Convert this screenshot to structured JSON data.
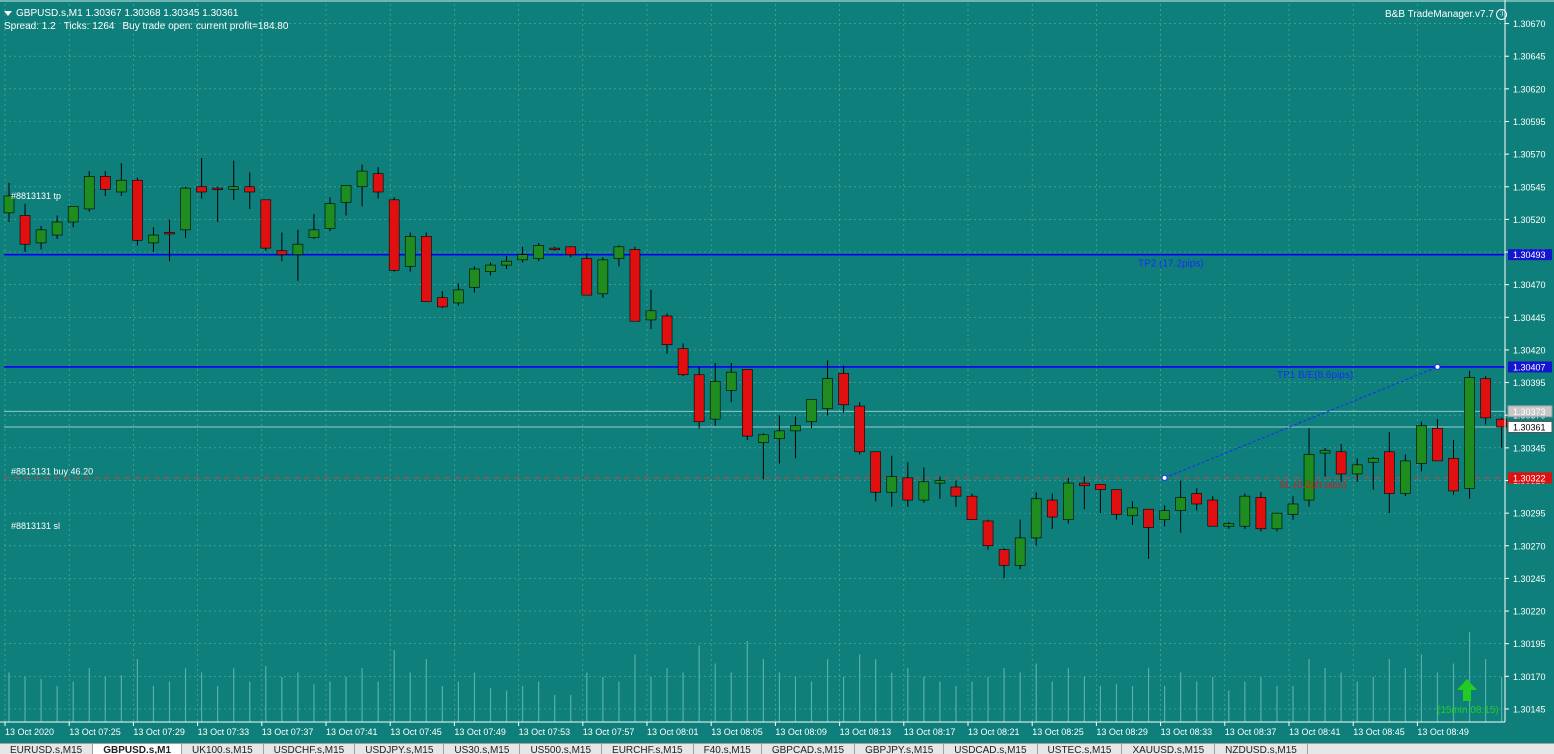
{
  "header": {
    "symbol_line": "GBPUSD.s,M1  1.30367 1.30368 1.30345 1.30361",
    "spread": "Spread: 1.2",
    "ticks": "Ticks: 1264",
    "trade_status": "Buy trade open: current profit=184.80"
  },
  "trade_manager_label": "B&B TradeManager.v7.7",
  "colors": {
    "background": "#0e7f7a",
    "grid": "#7fc3c0",
    "bull_candle": "#1e8c1e",
    "bear_candle": "#e01010",
    "candle_outline": "#000000",
    "tp_line": "#0000ff",
    "entry_line": "#d04040",
    "volume": "#56b0aa",
    "axis_text": "#ffffff",
    "price_box_blue": "#1515d0",
    "price_box_red": "#e01010",
    "arrow": "#22cc22"
  },
  "chart_data": {
    "type": "candlestick",
    "symbol": "GBPUSD.s",
    "timeframe": "M1",
    "ylim": [
      1.30135,
      1.30685
    ],
    "y_ticks": [
      "1.30670",
      "1.30645",
      "1.30620",
      "1.30595",
      "1.30570",
      "1.30545",
      "1.30520",
      "1.30495",
      "1.30470",
      "1.30445",
      "1.30420",
      "1.30395",
      "1.30370",
      "1.30345",
      "1.30320",
      "1.30295",
      "1.30270",
      "1.30245",
      "1.30220",
      "1.30195",
      "1.30170",
      "1.30145"
    ],
    "x_ticks": [
      "13 Oct 2020",
      "13 Oct 07:25",
      "13 Oct 07:29",
      "13 Oct 07:33",
      "13 Oct 07:37",
      "13 Oct 07:41",
      "13 Oct 07:45",
      "13 Oct 07:49",
      "13 Oct 07:53",
      "13 Oct 07:57",
      "13 Oct 08:01",
      "13 Oct 08:05",
      "13 Oct 08:09",
      "13 Oct 08:13",
      "13 Oct 08:17",
      "13 Oct 08:21",
      "13 Oct 08:25",
      "13 Oct 08:29",
      "13 Oct 08:33",
      "13 Oct 08:37",
      "13 Oct 08:41",
      "13 Oct 08:45",
      "13 Oct 08:49"
    ],
    "candles": [
      {
        "o": 1.30525,
        "h": 1.30548,
        "l": 1.30518,
        "c": 1.30538
      },
      {
        "o": 1.30523,
        "h": 1.30532,
        "l": 1.30495,
        "c": 1.30501
      },
      {
        "o": 1.30502,
        "h": 1.30515,
        "l": 1.30497,
        "c": 1.30512
      },
      {
        "o": 1.30508,
        "h": 1.30523,
        "l": 1.30505,
        "c": 1.30518
      },
      {
        "o": 1.30518,
        "h": 1.3053,
        "l": 1.30514,
        "c": 1.3053
      },
      {
        "o": 1.30528,
        "h": 1.30557,
        "l": 1.30526,
        "c": 1.30553
      },
      {
        "o": 1.30553,
        "h": 1.30557,
        "l": 1.30538,
        "c": 1.30543
      },
      {
        "o": 1.30541,
        "h": 1.30563,
        "l": 1.30538,
        "c": 1.3055
      },
      {
        "o": 1.3055,
        "h": 1.30552,
        "l": 1.305,
        "c": 1.30504
      },
      {
        "o": 1.30502,
        "h": 1.30514,
        "l": 1.30495,
        "c": 1.30508
      },
      {
        "o": 1.3051,
        "h": 1.3052,
        "l": 1.30488,
        "c": 1.30509
      },
      {
        "o": 1.30512,
        "h": 1.30545,
        "l": 1.30506,
        "c": 1.30544
      },
      {
        "o": 1.30545,
        "h": 1.30567,
        "l": 1.30536,
        "c": 1.30541
      },
      {
        "o": 1.30544,
        "h": 1.30545,
        "l": 1.30518,
        "c": 1.30543
      },
      {
        "o": 1.30543,
        "h": 1.30565,
        "l": 1.30535,
        "c": 1.30545
      },
      {
        "o": 1.30545,
        "h": 1.30556,
        "l": 1.30528,
        "c": 1.30541
      },
      {
        "o": 1.30535,
        "h": 1.30535,
        "l": 1.30496,
        "c": 1.30498
      },
      {
        "o": 1.30496,
        "h": 1.3051,
        "l": 1.30488,
        "c": 1.30493
      },
      {
        "o": 1.30493,
        "h": 1.30512,
        "l": 1.30473,
        "c": 1.30501
      },
      {
        "o": 1.30506,
        "h": 1.30524,
        "l": 1.30505,
        "c": 1.30512
      },
      {
        "o": 1.30513,
        "h": 1.30537,
        "l": 1.30511,
        "c": 1.30532
      },
      {
        "o": 1.30533,
        "h": 1.30545,
        "l": 1.30523,
        "c": 1.30546
      },
      {
        "o": 1.30545,
        "h": 1.30562,
        "l": 1.3053,
        "c": 1.30557
      },
      {
        "o": 1.30555,
        "h": 1.3056,
        "l": 1.30536,
        "c": 1.30541
      },
      {
        "o": 1.30535,
        "h": 1.30537,
        "l": 1.3048,
        "c": 1.30481
      },
      {
        "o": 1.30484,
        "h": 1.3051,
        "l": 1.3048,
        "c": 1.30507
      },
      {
        "o": 1.30507,
        "h": 1.3051,
        "l": 1.30458,
        "c": 1.30457
      },
      {
        "o": 1.3046,
        "h": 1.30465,
        "l": 1.30452,
        "c": 1.30453
      },
      {
        "o": 1.30456,
        "h": 1.30471,
        "l": 1.30454,
        "c": 1.30466
      },
      {
        "o": 1.30468,
        "h": 1.30484,
        "l": 1.30464,
        "c": 1.30482
      },
      {
        "o": 1.3048,
        "h": 1.30487,
        "l": 1.30477,
        "c": 1.30485
      },
      {
        "o": 1.30485,
        "h": 1.30492,
        "l": 1.30482,
        "c": 1.30488
      },
      {
        "o": 1.30489,
        "h": 1.30499,
        "l": 1.30487,
        "c": 1.30493
      },
      {
        "o": 1.3049,
        "h": 1.30502,
        "l": 1.30488,
        "c": 1.305
      },
      {
        "o": 1.30498,
        "h": 1.30499,
        "l": 1.30496,
        "c": 1.30497
      },
      {
        "o": 1.30499,
        "h": 1.30499,
        "l": 1.30491,
        "c": 1.30493
      },
      {
        "o": 1.3049,
        "h": 1.30494,
        "l": 1.30463,
        "c": 1.30462
      },
      {
        "o": 1.30463,
        "h": 1.30491,
        "l": 1.3046,
        "c": 1.30489
      },
      {
        "o": 1.3049,
        "h": 1.305,
        "l": 1.30484,
        "c": 1.30499
      },
      {
        "o": 1.30497,
        "h": 1.30499,
        "l": 1.30445,
        "c": 1.30442
      },
      {
        "o": 1.30443,
        "h": 1.30466,
        "l": 1.30436,
        "c": 1.3045
      },
      {
        "o": 1.30446,
        "h": 1.30448,
        "l": 1.30417,
        "c": 1.30424
      },
      {
        "o": 1.30421,
        "h": 1.30425,
        "l": 1.304,
        "c": 1.30401
      },
      {
        "o": 1.30401,
        "h": 1.30407,
        "l": 1.3036,
        "c": 1.30365
      },
      {
        "o": 1.30367,
        "h": 1.3041,
        "l": 1.30362,
        "c": 1.30396
      },
      {
        "o": 1.30389,
        "h": 1.3041,
        "l": 1.3038,
        "c": 1.30403
      },
      {
        "o": 1.30405,
        "h": 1.30405,
        "l": 1.30351,
        "c": 1.30354
      },
      {
        "o": 1.30349,
        "h": 1.30356,
        "l": 1.30321,
        "c": 1.30355
      },
      {
        "o": 1.30352,
        "h": 1.3037,
        "l": 1.30333,
        "c": 1.30358
      },
      {
        "o": 1.30358,
        "h": 1.30369,
        "l": 1.30337,
        "c": 1.30362
      },
      {
        "o": 1.30365,
        "h": 1.3038,
        "l": 1.3036,
        "c": 1.30382
      },
      {
        "o": 1.30375,
        "h": 1.30412,
        "l": 1.3037,
        "c": 1.30398
      },
      {
        "o": 1.30402,
        "h": 1.30408,
        "l": 1.30372,
        "c": 1.30378
      },
      {
        "o": 1.30377,
        "h": 1.3038,
        "l": 1.3034,
        "c": 1.30342
      },
      {
        "o": 1.30342,
        "h": 1.30342,
        "l": 1.30304,
        "c": 1.30311
      },
      {
        "o": 1.30311,
        "h": 1.30339,
        "l": 1.303,
        "c": 1.30323
      },
      {
        "o": 1.30322,
        "h": 1.30334,
        "l": 1.303,
        "c": 1.30305
      },
      {
        "o": 1.30305,
        "h": 1.3033,
        "l": 1.30303,
        "c": 1.30319
      },
      {
        "o": 1.30318,
        "h": 1.30323,
        "l": 1.30306,
        "c": 1.3032
      },
      {
        "o": 1.30315,
        "h": 1.3032,
        "l": 1.303,
        "c": 1.30308
      },
      {
        "o": 1.30308,
        "h": 1.3031,
        "l": 1.3029,
        "c": 1.3029
      },
      {
        "o": 1.30289,
        "h": 1.3029,
        "l": 1.30267,
        "c": 1.3027
      },
      {
        "o": 1.30267,
        "h": 1.30268,
        "l": 1.30245,
        "c": 1.30255
      },
      {
        "o": 1.30255,
        "h": 1.3029,
        "l": 1.30252,
        "c": 1.30276
      },
      {
        "o": 1.30276,
        "h": 1.30311,
        "l": 1.3027,
        "c": 1.30306
      },
      {
        "o": 1.30305,
        "h": 1.3031,
        "l": 1.30283,
        "c": 1.30292
      },
      {
        "o": 1.3029,
        "h": 1.30322,
        "l": 1.30287,
        "c": 1.30318
      },
      {
        "o": 1.30318,
        "h": 1.30323,
        "l": 1.30298,
        "c": 1.30316
      },
      {
        "o": 1.30317,
        "h": 1.30315,
        "l": 1.30295,
        "c": 1.30313
      },
      {
        "o": 1.30313,
        "h": 1.30312,
        "l": 1.3029,
        "c": 1.30294
      },
      {
        "o": 1.30293,
        "h": 1.30304,
        "l": 1.30286,
        "c": 1.30299
      },
      {
        "o": 1.30298,
        "h": 1.30298,
        "l": 1.3026,
        "c": 1.30284
      },
      {
        "o": 1.3029,
        "h": 1.30301,
        "l": 1.30285,
        "c": 1.30297
      },
      {
        "o": 1.30297,
        "h": 1.3032,
        "l": 1.3028,
        "c": 1.30307
      },
      {
        "o": 1.3031,
        "h": 1.30314,
        "l": 1.30297,
        "c": 1.30302
      },
      {
        "o": 1.30305,
        "h": 1.30308,
        "l": 1.30287,
        "c": 1.30285
      },
      {
        "o": 1.30285,
        "h": 1.30288,
        "l": 1.30283,
        "c": 1.30287
      },
      {
        "o": 1.30285,
        "h": 1.3031,
        "l": 1.30283,
        "c": 1.30308
      },
      {
        "o": 1.30307,
        "h": 1.30311,
        "l": 1.30281,
        "c": 1.30283
      },
      {
        "o": 1.30283,
        "h": 1.30295,
        "l": 1.30281,
        "c": 1.30295
      },
      {
        "o": 1.30294,
        "h": 1.30308,
        "l": 1.3029,
        "c": 1.30302
      },
      {
        "o": 1.30305,
        "h": 1.3036,
        "l": 1.303,
        "c": 1.3034
      },
      {
        "o": 1.30341,
        "h": 1.30345,
        "l": 1.30323,
        "c": 1.30343
      },
      {
        "o": 1.30342,
        "h": 1.30348,
        "l": 1.30319,
        "c": 1.30325
      },
      {
        "o": 1.30325,
        "h": 1.30337,
        "l": 1.30319,
        "c": 1.30332
      },
      {
        "o": 1.30334,
        "h": 1.30338,
        "l": 1.30313,
        "c": 1.30337
      },
      {
        "o": 1.30342,
        "h": 1.30357,
        "l": 1.30295,
        "c": 1.3031
      },
      {
        "o": 1.3031,
        "h": 1.3034,
        "l": 1.30308,
        "c": 1.30335
      },
      {
        "o": 1.30333,
        "h": 1.30365,
        "l": 1.30327,
        "c": 1.30362
      },
      {
        "o": 1.3036,
        "h": 1.30367,
        "l": 1.30335,
        "c": 1.30335
      },
      {
        "o": 1.30337,
        "h": 1.30351,
        "l": 1.30309,
        "c": 1.30312
      },
      {
        "o": 1.30314,
        "h": 1.30404,
        "l": 1.30306,
        "c": 1.30399
      },
      {
        "o": 1.30398,
        "h": 1.304,
        "l": 1.30363,
        "c": 1.30368
      },
      {
        "o": 1.30367,
        "h": 1.30368,
        "l": 1.30345,
        "c": 1.30361
      }
    ],
    "volumes": [
      0.55,
      0.5,
      0.48,
      0.4,
      0.45,
      0.6,
      0.5,
      0.52,
      0.7,
      0.4,
      0.45,
      0.6,
      0.55,
      0.4,
      0.6,
      0.45,
      0.62,
      0.5,
      0.55,
      0.42,
      0.45,
      0.5,
      0.6,
      0.45,
      0.8,
      0.55,
      0.7,
      0.4,
      0.45,
      0.55,
      0.38,
      0.35,
      0.4,
      0.45,
      0.3,
      0.3,
      0.55,
      0.5,
      0.45,
      0.75,
      0.5,
      0.6,
      0.55,
      0.85,
      0.65,
      0.55,
      0.9,
      0.7,
      0.55,
      0.5,
      0.45,
      0.7,
      0.5,
      0.75,
      0.7,
      0.55,
      0.6,
      0.5,
      0.45,
      0.4,
      0.45,
      0.5,
      0.6,
      0.55,
      0.65,
      0.45,
      0.6,
      0.5,
      0.4,
      0.42,
      0.4,
      0.6,
      0.4,
      0.55,
      0.45,
      0.5,
      0.35,
      0.45,
      0.5,
      0.4,
      0.4,
      0.7,
      0.6,
      0.55,
      0.45,
      0.5,
      0.7,
      0.6,
      0.75,
      0.55,
      0.65,
      1.0,
      0.7,
      0.5
    ],
    "horizontal_lines": [
      {
        "name": "tp2-line",
        "price": 1.30493,
        "price_label": "1.30493",
        "label": "TP2 (17.2pips)",
        "color": "#0000ff",
        "style": "solid"
      },
      {
        "name": "tp1-line",
        "price": 1.30407,
        "price_label": "1.30407",
        "label": "TP1 B/E(8.6pips)",
        "color": "#0000ff",
        "style": "solid"
      },
      {
        "name": "entry-line",
        "price": 1.30322,
        "price_label": "1.30322",
        "label": "SL (0.2pft pips)",
        "color": "#d04040",
        "style": "dashed"
      }
    ],
    "object_labels": [
      {
        "text": "#8813131 tp",
        "price": 1.30538
      },
      {
        "text": "#8813131 buy 46.20",
        "price": 1.30327
      },
      {
        "text": "#8813131 sl",
        "price": 1.30285
      }
    ],
    "bid_label": "1.30361",
    "ask_label": "1.30373",
    "bid_price": 1.30361,
    "ask_price": 1.30373,
    "trade_line": {
      "from_index": 72,
      "from_price": 1.30322,
      "to_index": 89,
      "to_price": 1.30407
    },
    "countdown_label": "(15min 08:15)"
  },
  "tabs": [
    {
      "label": "EURUSD.s,M15",
      "active": false
    },
    {
      "label": "GBPUSD.s,M1",
      "active": true
    },
    {
      "label": "UK100.s,M15",
      "active": false
    },
    {
      "label": "USDCHF.s,M15",
      "active": false
    },
    {
      "label": "USDJPY.s,M15",
      "active": false
    },
    {
      "label": "US30.s,M15",
      "active": false
    },
    {
      "label": "US500.s,M15",
      "active": false
    },
    {
      "label": "EURCHF.s,M15",
      "active": false
    },
    {
      "label": "F40.s,M15",
      "active": false
    },
    {
      "label": "GBPCAD.s,M15",
      "active": false
    },
    {
      "label": "GBPJPY.s,M15",
      "active": false
    },
    {
      "label": "USDCAD.s,M15",
      "active": false
    },
    {
      "label": "USTEC.s,M15",
      "active": false
    },
    {
      "label": "XAUUSD.s,M15",
      "active": false
    },
    {
      "label": "NZDUSD.s,M15",
      "active": false
    }
  ]
}
